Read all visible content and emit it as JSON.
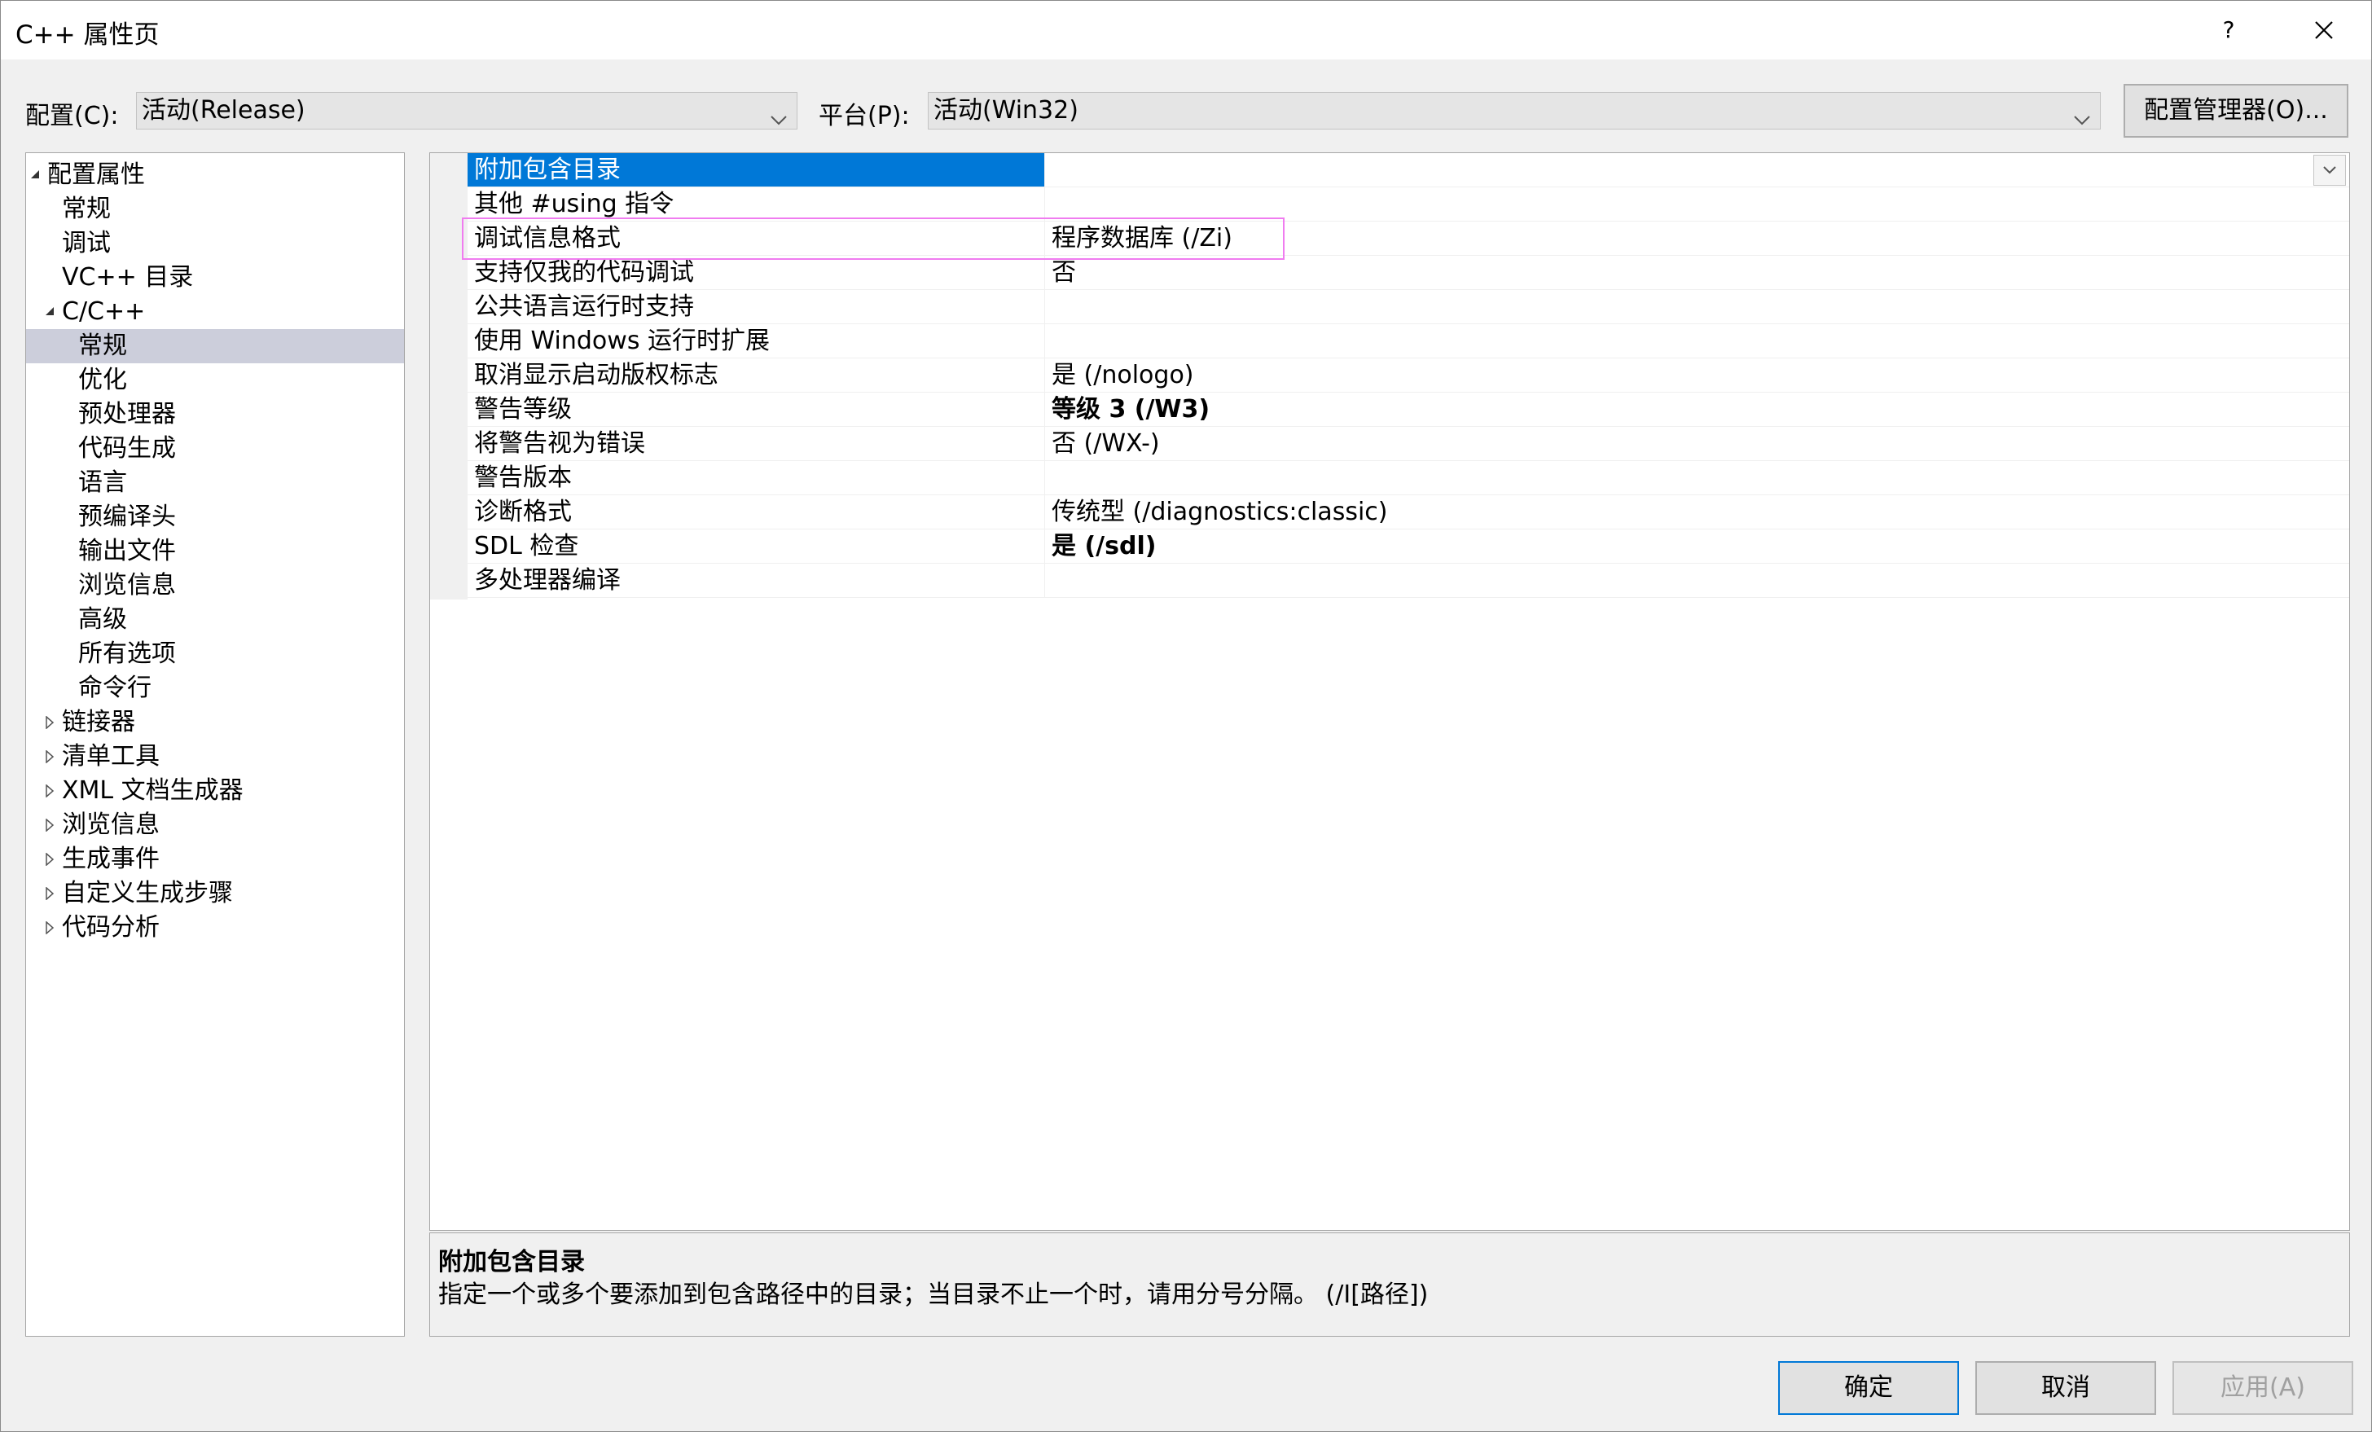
{
  "window": {
    "title": "C++ 属性页",
    "help_label": "?",
    "close_icon": "close-icon"
  },
  "config_bar": {
    "config_label": "配置(C):",
    "config_value": "活动(Release)",
    "platform_label": "平台(P):",
    "platform_value": "活动(Win32)",
    "manager_button": "配置管理器(O)..."
  },
  "tree": {
    "items": [
      {
        "label": "配置属性",
        "expander": "expanded"
      },
      {
        "label": "常规",
        "expander": "none"
      },
      {
        "label": "调试",
        "expander": "none"
      },
      {
        "label": "VC++ 目录",
        "expander": "none"
      },
      {
        "label": "C/C++",
        "expander": "expanded"
      },
      {
        "label": "常规",
        "expander": "none",
        "selected": true
      },
      {
        "label": "优化",
        "expander": "none"
      },
      {
        "label": "预处理器",
        "expander": "none"
      },
      {
        "label": "代码生成",
        "expander": "none"
      },
      {
        "label": "语言",
        "expander": "none"
      },
      {
        "label": "预编译头",
        "expander": "none"
      },
      {
        "label": "输出文件",
        "expander": "none"
      },
      {
        "label": "浏览信息",
        "expander": "none"
      },
      {
        "label": "高级",
        "expander": "none"
      },
      {
        "label": "所有选项",
        "expander": "none"
      },
      {
        "label": "命令行",
        "expander": "none"
      },
      {
        "label": "链接器",
        "expander": "collapsed"
      },
      {
        "label": "清单工具",
        "expander": "collapsed"
      },
      {
        "label": "XML 文档生成器",
        "expander": "collapsed"
      },
      {
        "label": "浏览信息",
        "expander": "collapsed"
      },
      {
        "label": "生成事件",
        "expander": "collapsed"
      },
      {
        "label": "自定义生成步骤",
        "expander": "collapsed"
      },
      {
        "label": "代码分析",
        "expander": "collapsed"
      }
    ]
  },
  "properties": {
    "rows": [
      {
        "name": "附加包含目录",
        "value": "",
        "selected": true
      },
      {
        "name": "其他 #using 指令",
        "value": ""
      },
      {
        "name": "调试信息格式",
        "value": "程序数据库 (/Zi)"
      },
      {
        "name": "支持仅我的代码调试",
        "value": "否"
      },
      {
        "name": "公共语言运行时支持",
        "value": ""
      },
      {
        "name": "使用 Windows 运行时扩展",
        "value": ""
      },
      {
        "name": "取消显示启动版权标志",
        "value": "是 (/nologo)"
      },
      {
        "name": "警告等级",
        "value": "等级 3 (/W3)",
        "bold": true
      },
      {
        "name": "将警告视为错误",
        "value": "否 (/WX-)"
      },
      {
        "name": "警告版本",
        "value": ""
      },
      {
        "name": "诊断格式",
        "value": "传统型 (/diagnostics:classic)"
      },
      {
        "name": "SDL 检查",
        "value": "是 (/sdl)",
        "bold": true
      },
      {
        "name": "多处理器编译",
        "value": ""
      }
    ],
    "highlight_color": "#f07cf0",
    "selection_color": "#0078d7"
  },
  "description": {
    "title": "附加包含目录",
    "text": "指定一个或多个要添加到包含路径中的目录；当目录不止一个时，请用分号分隔。     (/I[路径])"
  },
  "footer": {
    "ok": "确定",
    "cancel": "取消",
    "apply": "应用(A)"
  }
}
